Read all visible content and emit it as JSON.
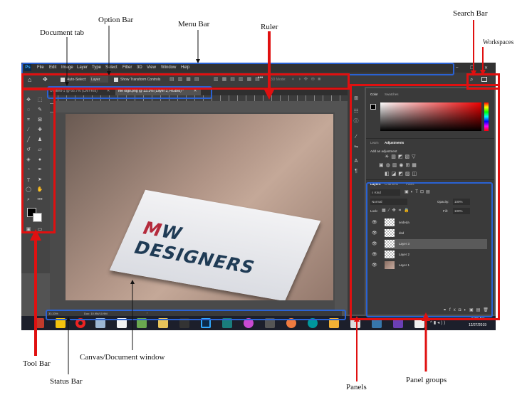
{
  "labels": {
    "option_bar": "Option Bar",
    "menu_bar": "Menu Bar",
    "document_tab": "Document tab",
    "ruler": "Ruler",
    "search_bar": "Search Bar",
    "workspaces": "Workspaces",
    "tool_bar": "Tool Bar",
    "canvas_window": "Canvas/Document window",
    "status_bar": "Status Bar",
    "panels": "Panels",
    "panel_groups": "Panel groups"
  },
  "app": {
    "logo_text": "Ps",
    "menu": [
      "File",
      "Edit",
      "Image",
      "Layer",
      "Type",
      "Select",
      "Filter",
      "3D",
      "View",
      "Window",
      "Help"
    ],
    "window_controls": [
      "–",
      "❐",
      "✕"
    ]
  },
  "options": {
    "auto_select_label": "Auto-Select:",
    "auto_select_value": "Layer",
    "transform_label": "Show Transform Controls",
    "mode_label": "3D Mode:"
  },
  "tabs": [
    {
      "label": "Untitled-1 @ 66.7% (CMYK/8)"
    },
    {
      "label": "me logo.png @ 33.3% (Layer 3, RGB/8) *"
    }
  ],
  "canvas": {
    "logo_prefix": "M",
    "logo_text": "W DESIGNERS"
  },
  "status": {
    "zoom": "33.33%",
    "doc": "Doc: 10.9M/10.9M"
  },
  "panel_color": {
    "tabs": [
      "Color",
      "Swatches"
    ]
  },
  "panel_adjust": {
    "tabs": [
      "Learn",
      "Adjustments"
    ],
    "heading": "Add an adjustment"
  },
  "panel_layers": {
    "tabs": [
      "Layers",
      "Channels",
      "Paths"
    ],
    "kind": "Kind",
    "blend": "Normal",
    "opacity_label": "Opacity:",
    "opacity": "100%",
    "lock_label": "Lock:",
    "fill_label": "Fill:",
    "fill": "100%",
    "layers": [
      "sededa",
      "dsd",
      "Layer 3",
      "Layer 2",
      "Layer 1"
    ]
  },
  "taskbar": {
    "time": "3:23 AM",
    "date": "12/27/2019"
  },
  "colors": {
    "highlight_blue": "#2a62d4",
    "arrow_red": "#e01010"
  }
}
